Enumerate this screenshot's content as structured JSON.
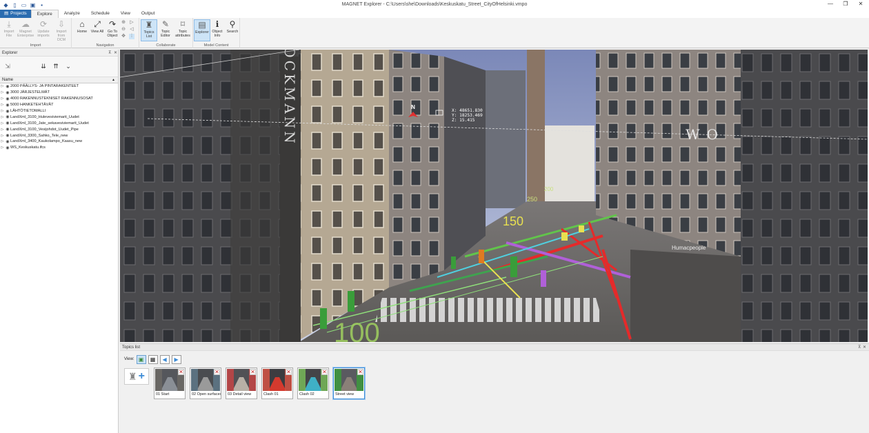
{
  "window": {
    "title": "MAGNET Explorer - C:\\Users\\she\\Downloads\\Keskuskatu_Street_CityOfHelsinki.vmpo",
    "minimize": "—",
    "maximize": "❐",
    "close": "✕"
  },
  "ribbon": {
    "tabs": [
      "Projects",
      "Explore",
      "Analyze",
      "Schedule",
      "View",
      "Output"
    ],
    "active_tab": "Explore",
    "groups": {
      "import": {
        "label": "Import",
        "buttons": [
          "Import File",
          "Magnet Enterprise",
          "Update imports",
          "Import from DCM"
        ]
      },
      "navigation": {
        "label": "Navigation",
        "buttons": [
          "Home",
          "View All",
          "Go To Object"
        ]
      },
      "collaborate": {
        "label": "Collaborate",
        "buttons": [
          "Topics List",
          "Topic Editor",
          "Topic attributes"
        ]
      },
      "model_content": {
        "label": "Model Content",
        "buttons": [
          "Explorer",
          "Object Info",
          "Search"
        ]
      }
    }
  },
  "explorer": {
    "title": "Explorer",
    "column_header": "Name",
    "items": [
      "2000 PÄÄLLYS- JA PINTARAKENTEET",
      "3000 JÄRJESTELMÄT",
      "4000 RAKENNUSTEKNISET RAKENNUSOSAT",
      "5000 HANKETEHTÄVÄT",
      "LÄHTÖTIETOMALLI",
      "LandXml_3100_Hulevesiviemarit_Uudet",
      "LandXml_3100_Jate_sekavesiviemarit_Uudet",
      "LandXml_3100_Vesijohdot_Uudet_Pipe",
      "LandXml_3300_Sahko_Tele_new",
      "LandXml_3400_Kaukolampo_Kaasu_new",
      "WS_Keskuskatu.ifcs"
    ]
  },
  "viewport": {
    "coords": {
      "x": "X: 48651.830",
      "y": "Y: 18253.469",
      "z": "Z: 15.415"
    },
    "compass": "N",
    "signs": {
      "stockmann": "STOCKMANN",
      "wo": "WO",
      "humac": "Humacpeople"
    },
    "labels": {
      "l150": "150",
      "l100": "100",
      "l200": "200",
      "l250": "250"
    }
  },
  "topics": {
    "title": "Topics list",
    "view_label": "View:",
    "items": [
      {
        "label": "01 Start"
      },
      {
        "label": "02 Open surfaces"
      },
      {
        "label": "03 Detail view"
      },
      {
        "label": "Clash 01"
      },
      {
        "label": "Clash 02"
      },
      {
        "label": "Street view"
      }
    ],
    "selected": "Street view"
  }
}
